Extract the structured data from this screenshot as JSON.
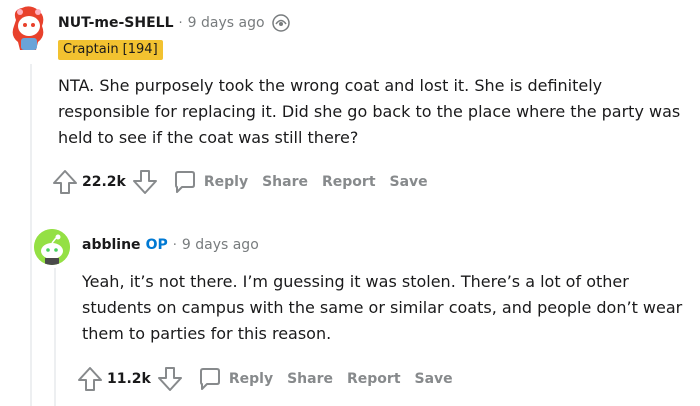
{
  "comments": [
    {
      "username": "NUT-me-SHELL",
      "separator": "·",
      "time": "9 days ago",
      "flair": "Craptain [194]",
      "body": "NTA. She purposely took the wrong coat and lost it. She is definitely responsible for replacing it. Did she go back to the place where the party was held to see if the coat was still there?",
      "score": "22.2k",
      "actions": {
        "reply": "Reply",
        "share": "Share",
        "report": "Report",
        "save": "Save"
      },
      "icons": {
        "avatar": "snoo-avatar-icon",
        "award": "award-icon",
        "upvote": "upvote-arrow-icon",
        "downvote": "downvote-arrow-icon",
        "reply": "comment-bubble-icon"
      }
    },
    {
      "username": "abbline",
      "op_badge": "OP",
      "separator": "·",
      "time": "9 days ago",
      "body": "Yeah, it’s not there. I’m guessing it was stolen. There’s a lot of other students on campus with the same or similar coats, and people don’t wear them to parties for this reason.",
      "score": "11.2k",
      "actions": {
        "reply": "Reply",
        "share": "Share",
        "report": "Report",
        "save": "Save"
      },
      "icons": {
        "avatar": "snoo-avatar-icon",
        "upvote": "upvote-arrow-icon",
        "downvote": "downvote-arrow-icon",
        "reply": "comment-bubble-icon"
      }
    }
  ],
  "colors": {
    "flair_bg": "#f2c230",
    "op_blue": "#0079d3",
    "muted": "#878a8c",
    "thread_line": "#edeff1",
    "avatar2_bg": "#94e044"
  }
}
